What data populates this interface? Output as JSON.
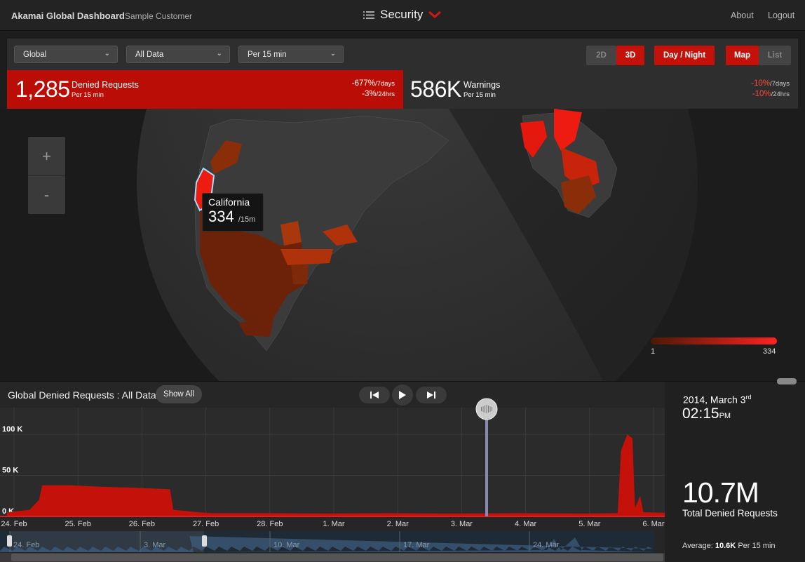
{
  "header": {
    "brand": "Akamai Global Dashboard",
    "customer": "Sample Customer",
    "section": "Security",
    "about": "About",
    "logout": "Logout"
  },
  "filters": {
    "region": "Global",
    "data": "All Data",
    "interval": "Per 15 min"
  },
  "toggles": {
    "view_2d": "2D",
    "view_3d": "3D",
    "day_night": "Day / Night",
    "map": "Map",
    "list": "List"
  },
  "stats": {
    "denied": {
      "value": "1,285",
      "label": "Denied Requests",
      "sub": "Per 15 min",
      "chg7": "-677%",
      "chg7_unit": "/7days",
      "chg24": "-3%",
      "chg24_unit": "/24hrs"
    },
    "warnings": {
      "value": "586K",
      "label": "Warnings",
      "sub": "Per 15 min",
      "chg7": "-10%",
      "chg7_unit": "/7days",
      "chg24": "-10%",
      "chg24_unit": "/24hrs"
    }
  },
  "map": {
    "zoom_in": "+",
    "zoom_out": "-",
    "tooltip": {
      "name": "California",
      "value": "334",
      "unit": "/15m"
    },
    "legend_min": "1",
    "legend_max": "334",
    "colors": {
      "low": "#4a1a05",
      "high": "#ff2222"
    }
  },
  "chart_panel": {
    "title": "Global Denied Requests : All Data",
    "show_all": "Show All"
  },
  "chart_data": {
    "type": "area",
    "title": "Global Denied Requests : All Data",
    "x_ticks": [
      "24. Feb",
      "25. Feb",
      "26. Feb",
      "27. Feb",
      "28. Feb",
      "1. Mar",
      "2. Mar",
      "3. Mar",
      "4. Mar",
      "5. Mar",
      "6. Mar"
    ],
    "y_ticks": [
      "0 K",
      "50 K",
      "100 K"
    ],
    "ylim": [
      0,
      130000
    ],
    "series": [
      {
        "color": "#c4120a",
        "points": [
          [
            0,
            5000
          ],
          [
            0.35,
            8000
          ],
          [
            0.5,
            20000
          ],
          [
            0.55,
            38000
          ],
          [
            1.0,
            38000
          ],
          [
            1.5,
            36000
          ],
          [
            2.0,
            35000
          ],
          [
            2.55,
            33000
          ],
          [
            2.6,
            8000
          ],
          [
            3.0,
            5000
          ],
          [
            3.2,
            4000
          ],
          [
            4.0,
            4000
          ],
          [
            5.0,
            3500
          ],
          [
            6.0,
            4000
          ],
          [
            7.0,
            3500
          ],
          [
            8.0,
            4000
          ],
          [
            9.0,
            3500
          ],
          [
            9.55,
            4000
          ],
          [
            9.6,
            80000
          ],
          [
            9.7,
            100000
          ],
          [
            9.78,
            95000
          ],
          [
            9.82,
            10000
          ],
          [
            9.9,
            25000
          ],
          [
            9.95,
            5000
          ],
          [
            10.5,
            4000
          ]
        ]
      }
    ],
    "navigator_ticks": [
      "24. Feb",
      "3. Mar",
      "10. Mar",
      "17. Mar",
      "24. Mar"
    ],
    "current_marker": 7.5
  },
  "info": {
    "date": "2014, March 3",
    "date_sup": "rd",
    "time": "02:15",
    "time_unit": "PM",
    "total": "10.7M",
    "total_label": "Total Denied Requests",
    "avg_label": "Average:",
    "avg_value": "10.6K",
    "avg_unit": "Per 15 min"
  }
}
